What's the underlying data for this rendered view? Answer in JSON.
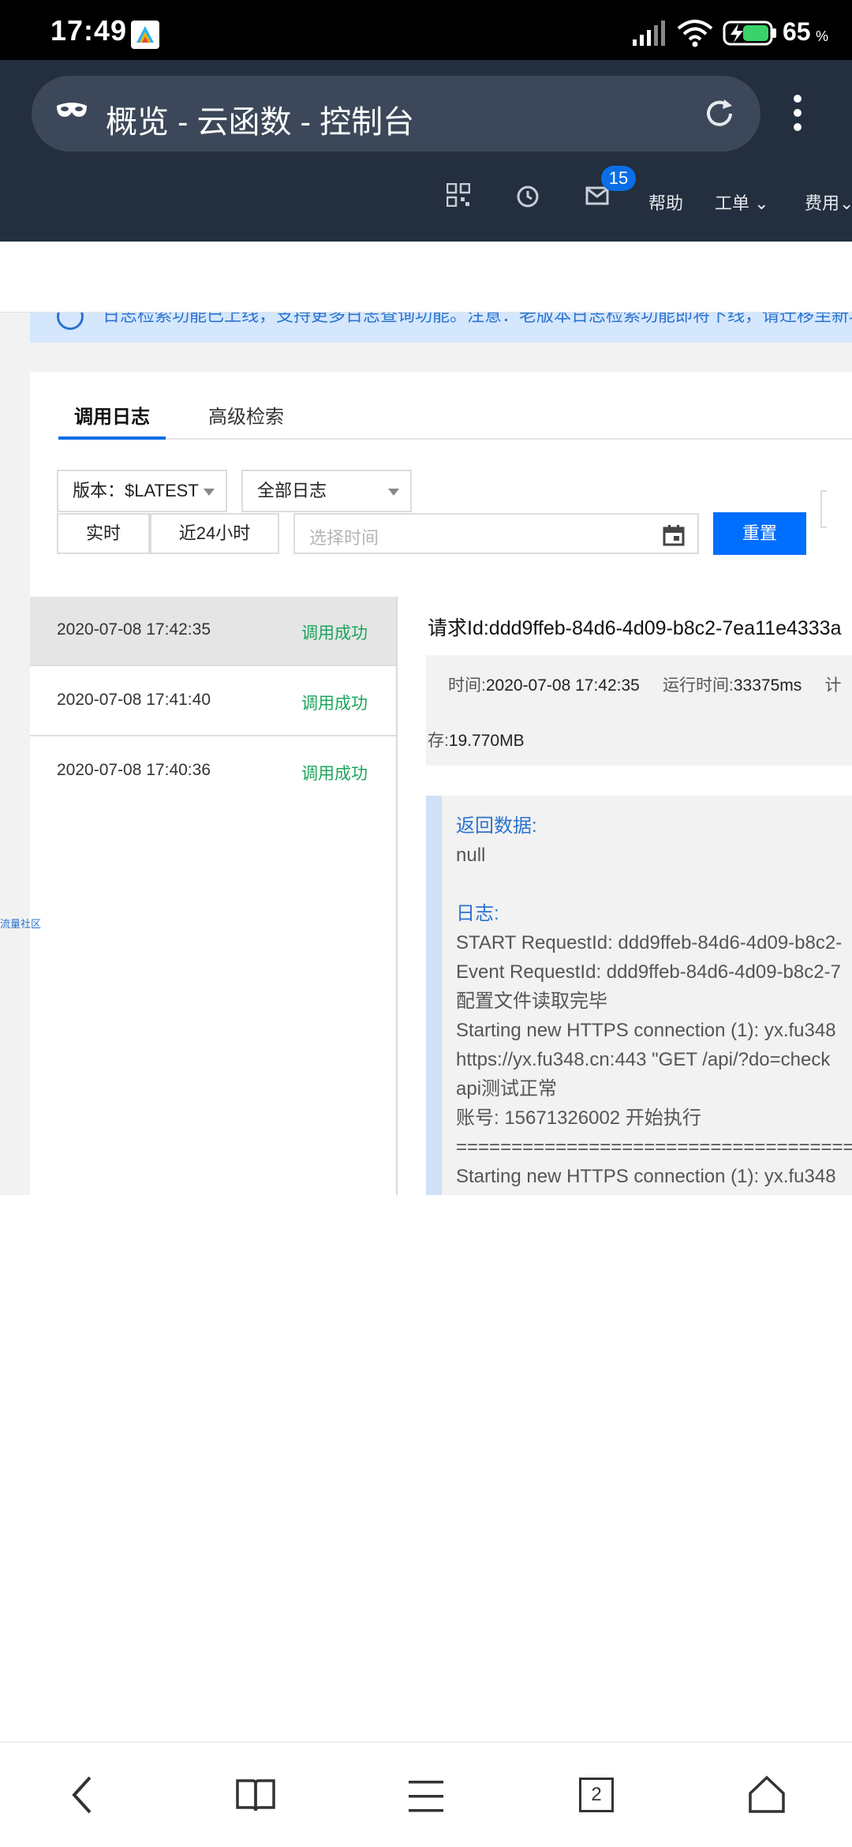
{
  "status_bar": {
    "time": "17:49",
    "battery_level": "65",
    "battery_unit": "%"
  },
  "browser": {
    "tab_title": "概览 - 云函数 - 控制台"
  },
  "console_nav": {
    "mail_badge": "15",
    "help": "帮助",
    "ticket": "工单",
    "billing": "费用"
  },
  "info_banner": {
    "text": "日志检索功能已上线，支持更多日志查询功能。注意：老版本日志检索功能即将下线，请迁移至新功能体验更多日志能力。"
  },
  "tabs": [
    {
      "label": "调用日志",
      "active": true
    },
    {
      "label": "高级检索",
      "active": false
    }
  ],
  "filters": {
    "version_label": "版本：",
    "version_value": "$LATEST",
    "log_type": "全部日志",
    "realtime": "实时",
    "last24h": "近24小时",
    "time_placeholder": "选择时间",
    "reset": "重置"
  },
  "log_list": [
    {
      "time": "2020-07-08 17:42:35",
      "status": "调用成功",
      "selected": true
    },
    {
      "time": "2020-07-08 17:41:40",
      "status": "调用成功",
      "selected": false
    },
    {
      "time": "2020-07-08 17:40:36",
      "status": "调用成功",
      "selected": false
    }
  ],
  "side_link": "流量社区",
  "detail": {
    "request_id_label": "请求Id:",
    "request_id": "ddd9ffeb-84d6-4d09-b8c2-7ea11e4333a",
    "time_label": "时间:",
    "time_value": "2020-07-08 17:42:35",
    "runtime_label": "运行时间:",
    "runtime_value": "33375ms",
    "cut_label": "计",
    "memory_label": "存:",
    "memory_value": "19.770MB",
    "return_label": "返回数据:",
    "return_value": "null",
    "log_label": "日志:",
    "log_lines": [
      "START RequestId: ddd9ffeb-84d6-4d09-b8c2-",
      "Event RequestId: ddd9ffeb-84d6-4d09-b8c2-7",
      "配置文件读取完毕",
      "Starting new HTTPS connection (1): yx.fu348",
      "https://yx.fu348.cn:443 \"GET /api/?do=check",
      "api测试正常",
      "账号: 15671326002  开始执行",
      "=========================================",
      "Starting new HTTPS connection (1): yx.fu348"
    ]
  },
  "bottom_nav": {
    "tab_count": "2"
  }
}
